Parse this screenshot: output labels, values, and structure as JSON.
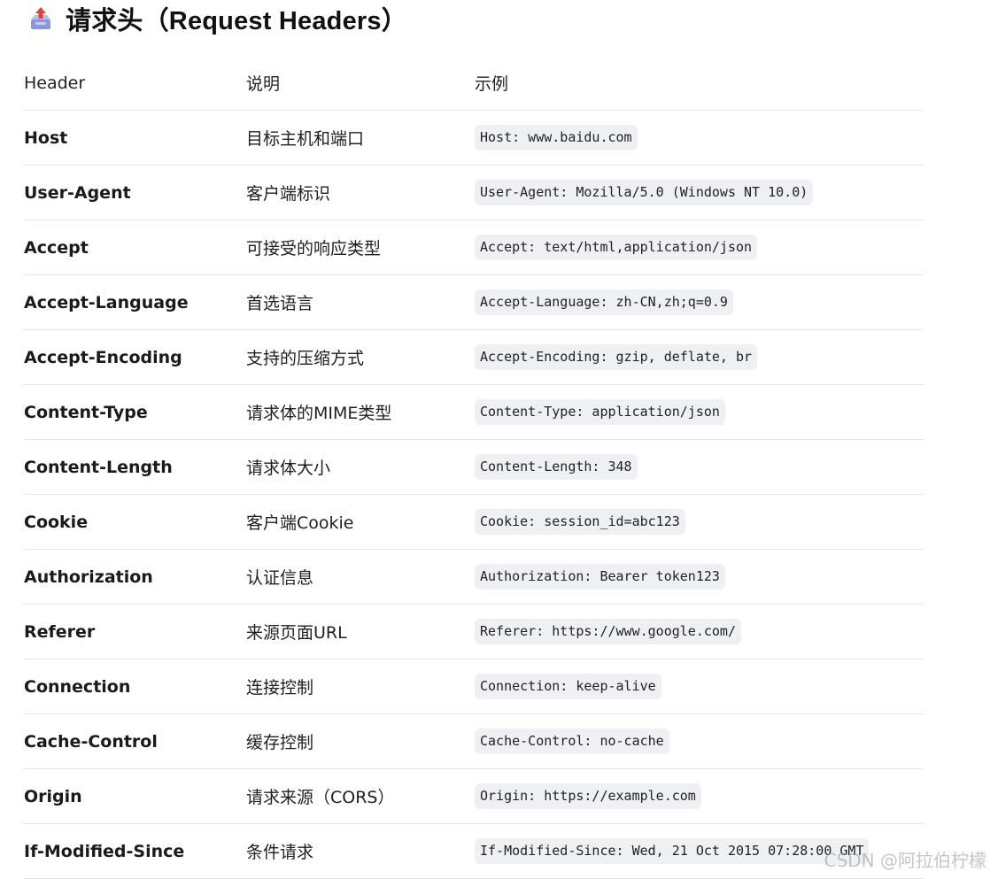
{
  "heading": {
    "icon": "outbox-tray-icon",
    "title": "请求头（Request Headers）"
  },
  "table": {
    "columns": [
      "Header",
      "说明",
      "示例"
    ],
    "rows": [
      {
        "name": "Host",
        "desc": "目标主机和端口",
        "example": "Host: www.baidu.com"
      },
      {
        "name": "User-Agent",
        "desc": "客户端标识",
        "example": "User-Agent: Mozilla/5.0 (Windows NT 10.0)"
      },
      {
        "name": "Accept",
        "desc": "可接受的响应类型",
        "example": "Accept: text/html,application/json"
      },
      {
        "name": "Accept-Language",
        "desc": "首选语言",
        "example": "Accept-Language: zh-CN,zh;q=0.9"
      },
      {
        "name": "Accept-Encoding",
        "desc": "支持的压缩方式",
        "example": "Accept-Encoding: gzip, deflate, br"
      },
      {
        "name": "Content-Type",
        "desc": "请求体的MIME类型",
        "example": "Content-Type: application/json"
      },
      {
        "name": "Content-Length",
        "desc": "请求体大小",
        "example": "Content-Length: 348"
      },
      {
        "name": "Cookie",
        "desc": "客户端Cookie",
        "example": "Cookie: session_id=abc123"
      },
      {
        "name": "Authorization",
        "desc": "认证信息",
        "example": "Authorization: Bearer token123"
      },
      {
        "name": "Referer",
        "desc": "来源页面URL",
        "example": "Referer: https://www.google.com/"
      },
      {
        "name": "Connection",
        "desc": "连接控制",
        "example": "Connection: keep-alive"
      },
      {
        "name": "Cache-Control",
        "desc": "缓存控制",
        "example": "Cache-Control: no-cache"
      },
      {
        "name": "Origin",
        "desc": "请求来源（CORS）",
        "example": "Origin: https://example.com"
      },
      {
        "name": "If-Modified-Since",
        "desc": "条件请求",
        "example": "If-Modified-Since: Wed, 21 Oct 2015 07:28:00 GMT"
      }
    ]
  },
  "watermark": "CSDN @阿拉伯柠檬"
}
